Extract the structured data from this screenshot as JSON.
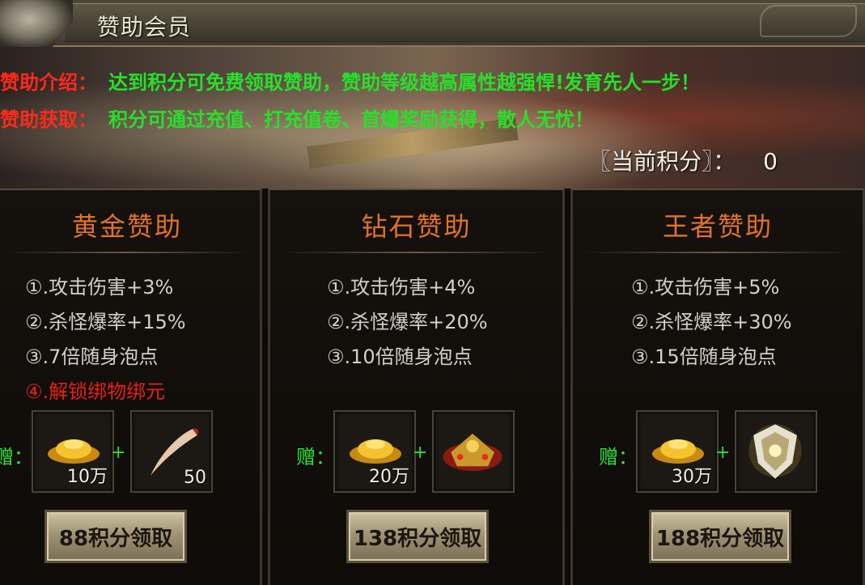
{
  "title": "赞助会员",
  "intro": {
    "label": "赞助介绍：",
    "text": "达到积分可免费领取赞助，赞助等级越高属性越强悍!发育先人一步！"
  },
  "obtain": {
    "label": "赞助获取：",
    "text": "积分可通过充值、打充值卷、首爆奖励获得，散人无忧！"
  },
  "points": {
    "label": "〖当前积分〗：",
    "value": "0"
  },
  "gift_label": "赠：",
  "plus": "+",
  "tiers": [
    {
      "name": "黄金赞助",
      "attrs": [
        "①.攻击伤害+3%",
        "②.杀怪爆率+15%",
        "③.7倍随身泡点",
        "④.解锁绑物绑元"
      ],
      "reward1_count": "10万",
      "reward2_count": "50",
      "button": "88积分领取"
    },
    {
      "name": "钻石赞助",
      "attrs": [
        "①.攻击伤害+4%",
        "②.杀怪爆率+20%",
        "③.10倍随身泡点"
      ],
      "reward1_count": "20万",
      "button": "138积分领取"
    },
    {
      "name": "王者赞助",
      "attrs": [
        "①.攻击伤害+5%",
        "②.杀怪爆率+30%",
        "③.15倍随身泡点"
      ],
      "reward1_count": "30万",
      "button": "188积分领取"
    }
  ]
}
